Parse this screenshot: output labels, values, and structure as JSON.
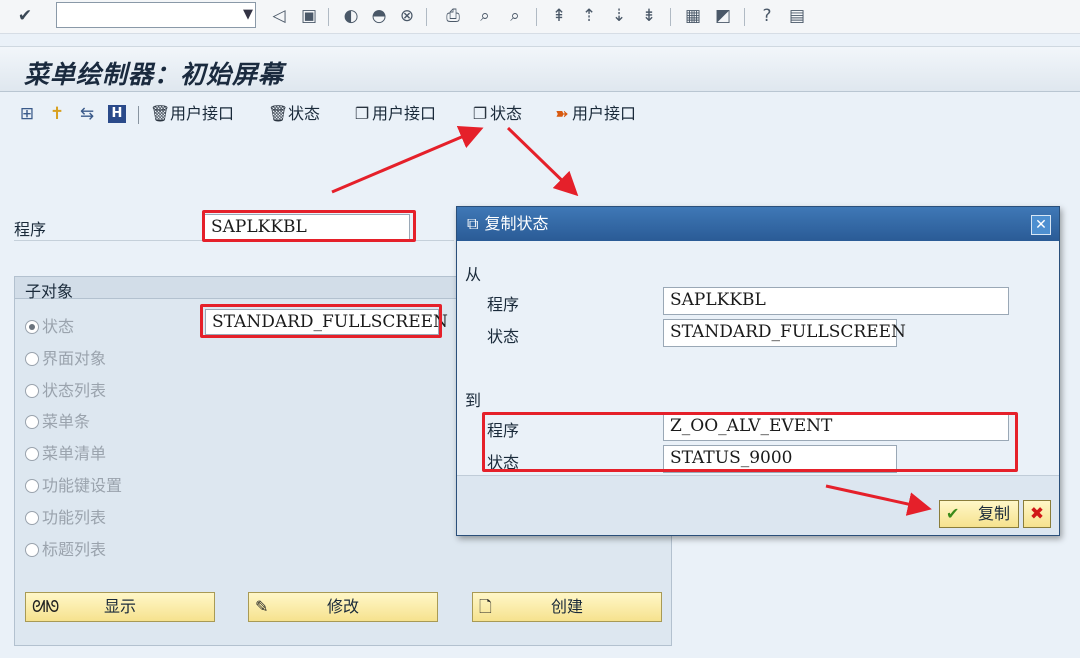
{
  "system_toolbar": {
    "command_field_value": "",
    "icons": [
      "check-icon",
      "back-icon",
      "save-icon",
      "nav-back-icon",
      "exit-icon",
      "cancel-icon",
      "print-icon",
      "find-icon",
      "find-next-icon",
      "first-page-icon",
      "prev-page-icon",
      "next-page-icon",
      "last-page-icon",
      "new-session-icon",
      "shortcut-icon",
      "help-icon",
      "layout-icon"
    ]
  },
  "title": "菜单绘制器：初始屏幕",
  "app_toolbar": {
    "buttons": [
      {
        "icon": "delete-icon",
        "label": "用户接口"
      },
      {
        "icon": "delete-icon",
        "label": "状态"
      },
      {
        "icon": "copy-icon",
        "label": "用户接口"
      },
      {
        "icon": "copy-icon",
        "label": "状态"
      },
      {
        "icon": "rename-icon",
        "label": "用户接口"
      }
    ]
  },
  "main": {
    "program_label": "程序",
    "program_value": "SAPLKKBL",
    "subobjects_title": "子对象",
    "status_value": "STANDARD_FULLSCREEN",
    "radios": [
      {
        "label": "状态",
        "selected": true
      },
      {
        "label": "界面对象",
        "selected": false
      },
      {
        "label": "状态列表",
        "selected": false
      },
      {
        "label": "菜单条",
        "selected": false
      },
      {
        "label": "菜单清单",
        "selected": false
      },
      {
        "label": "功能键设置",
        "selected": false
      },
      {
        "label": "功能列表",
        "selected": false
      },
      {
        "label": "标题列表",
        "selected": false
      }
    ],
    "buttons": [
      {
        "icon": "glasses-icon",
        "label": "显示"
      },
      {
        "icon": "pencil-icon",
        "label": "修改"
      },
      {
        "icon": "document-icon",
        "label": "创建"
      }
    ]
  },
  "dialog": {
    "title": "复制状态",
    "from_label": "从",
    "from_program_label": "程序",
    "from_program_value": "SAPLKKBL",
    "from_status_label": "状态",
    "from_status_value": "STANDARD_FULLSCREEN",
    "to_label": "到",
    "to_program_label": "程序",
    "to_program_value": "Z_OO_ALV_EVENT",
    "to_status_label": "状态",
    "to_status_value": "STATUS_9000",
    "copy_button_label": "复制"
  },
  "colors": {
    "annotation_red": "#e5202a",
    "dialog_title_blue": "#2a5b96",
    "button_yellow": "#f6e28e"
  }
}
